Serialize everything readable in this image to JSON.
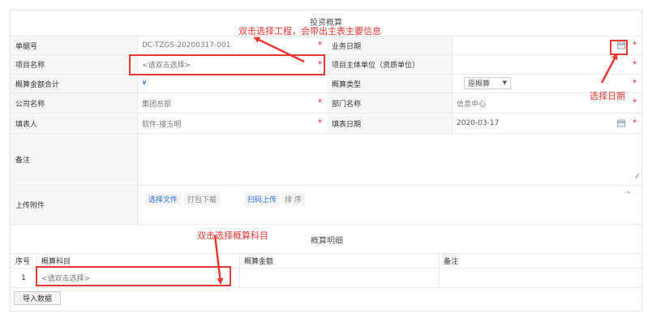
{
  "form": {
    "title": "投资概算",
    "rows": [
      {
        "label": "单据号",
        "value": "DC-TZGS-20200317-001",
        "right_label": "业务日期",
        "right_value": ""
      },
      {
        "label": "项目名称",
        "value": "<请双击选择>",
        "right_label": "项目主体单位（资质单位）",
        "right_value": ""
      },
      {
        "label": "概算金额合计",
        "value": "¥",
        "right_label": "概算类型",
        "right_value": "原概算"
      },
      {
        "label": "公司名称",
        "value": "集团总部",
        "right_label": "部门名称",
        "right_value": "信息中心"
      },
      {
        "label": "填表人",
        "value": "软件-接玉明",
        "right_label": "填表日期",
        "right_value": "2020-03-17"
      }
    ],
    "required_mark": "*",
    "remark_label": "备注",
    "attach_label": "上传附件",
    "attach_buttons": {
      "select_file": "选择文件",
      "pack_download": "打包下载",
      "scan_upload": "扫码上传",
      "sort": "排 序"
    }
  },
  "detail": {
    "title": "概算明细",
    "columns": [
      "序号",
      "概算科目",
      "概算金额",
      "备注"
    ],
    "rows": [
      {
        "index": "1",
        "subject": "<请双击选择>",
        "amount": "",
        "remark": ""
      }
    ],
    "import_button": "导入数据"
  },
  "annotations": {
    "top": "双击选择工程，会带出主表主要信息",
    "right": "选择日期",
    "detail": "双击选择概算科目"
  },
  "colors": {
    "annotation_red": "#e53935",
    "required_red": "#e02020",
    "link_blue": "#2a6fd6"
  },
  "icons": {
    "date_picker": "calendar-icon",
    "select_caret": "caret-down-icon",
    "resize": "resize-grip-icon"
  }
}
